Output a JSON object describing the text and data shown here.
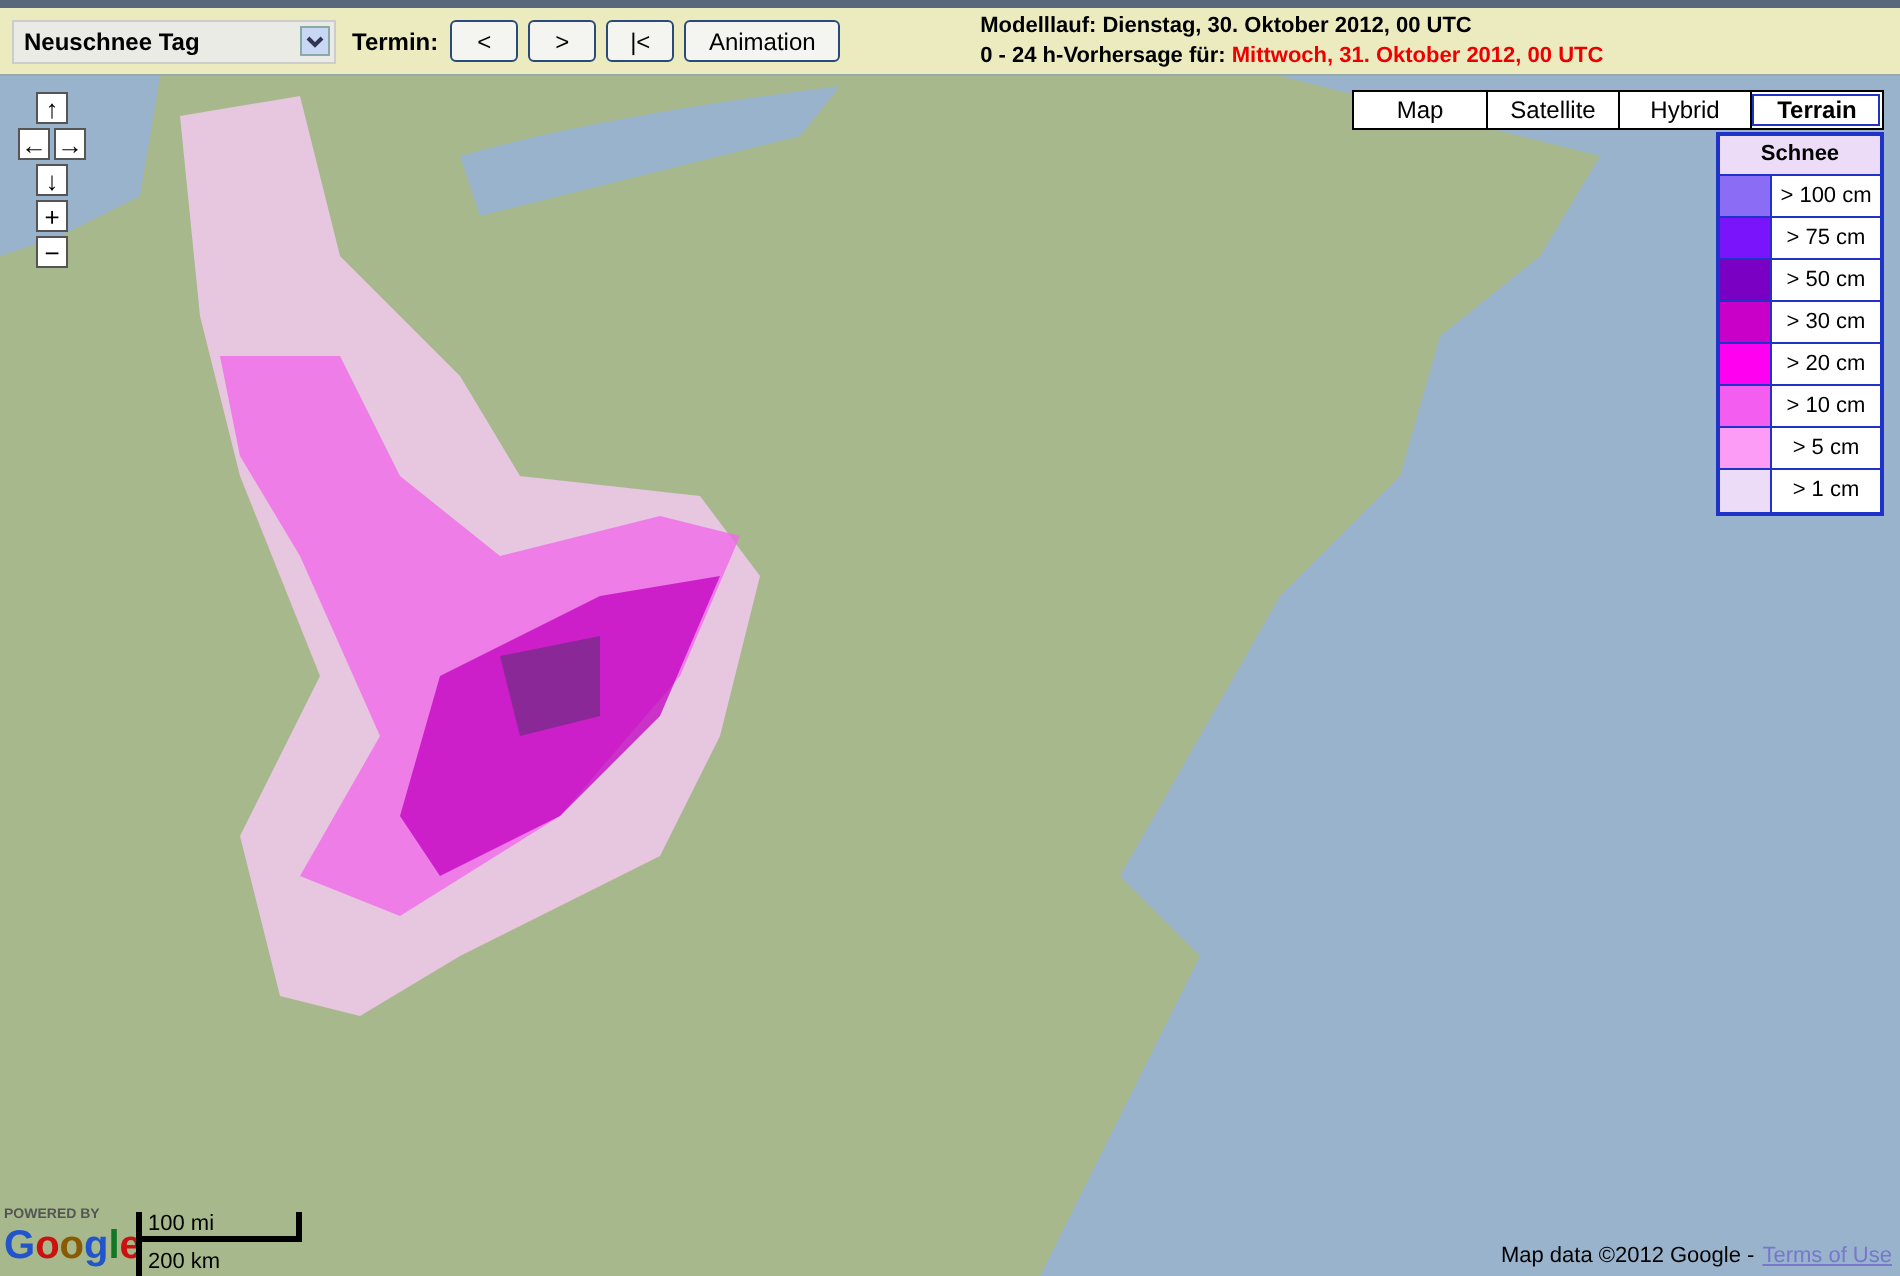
{
  "toolbar": {
    "product_select": {
      "value": "Neuschnee Tag"
    },
    "termin_label": "Termin:",
    "buttons": [
      "<",
      ">",
      "|<",
      "Animation"
    ],
    "model_run": {
      "label": "Modelllauf:",
      "value": "Dienstag, 30. Oktober 2012, 00 UTC"
    },
    "forecast": {
      "label": "0 - 24 h-Vorhersage für:",
      "value": "Mittwoch, 31. Oktober 2012, 00 UTC"
    }
  },
  "map": {
    "pan_controls": [
      "↑",
      "←",
      "→",
      "↓"
    ],
    "zoom_controls": [
      "+",
      "−"
    ],
    "map_types": [
      {
        "label": "Map",
        "selected": false
      },
      {
        "label": "Satellite",
        "selected": false
      },
      {
        "label": "Hybrid",
        "selected": false
      },
      {
        "label": "Terrain",
        "selected": true
      }
    ],
    "legend": {
      "title": "Schnee",
      "items": [
        {
          "label": "> 100 cm",
          "color": "#8b6cf5"
        },
        {
          "label": "> 75 cm",
          "color": "#7a14fa"
        },
        {
          "label": "> 50 cm",
          "color": "#7a00c4"
        },
        {
          "label": "> 30 cm",
          "color": "#c800c8"
        },
        {
          "label": "> 20 cm",
          "color": "#ff00f0"
        },
        {
          "label": "> 10 cm",
          "color": "#f45ef0"
        },
        {
          "label": "> 5 cm",
          "color": "#fc9cf6"
        },
        {
          "label": "> 1 cm",
          "color": "#ecdcf8"
        }
      ]
    },
    "powered_by": "POWERED BY",
    "logo": "Google",
    "scale": {
      "miles": "100 mi",
      "km": "200 km"
    },
    "attribution": {
      "text": "Map data ©2012 Google -",
      "link": "Terms of Use"
    }
  }
}
